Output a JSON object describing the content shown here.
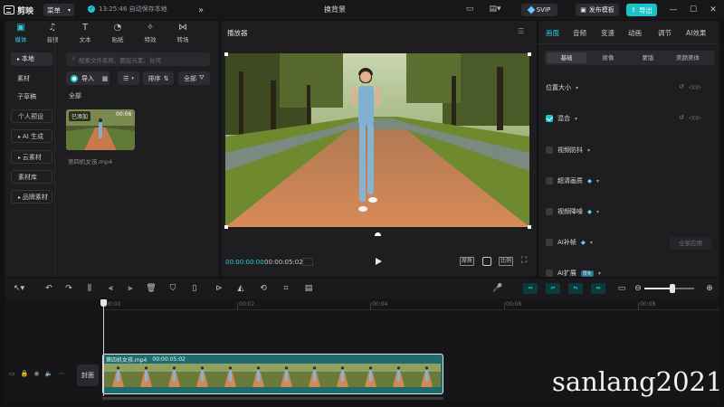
{
  "titlebar": {
    "logo_text": "剪映",
    "menu_label": "菜单",
    "save_status": "13:25:46 自动保存本地",
    "project_title": "换背景",
    "svip_label": "SVIP",
    "publish_label": "发布模板",
    "export_label": "导出"
  },
  "media_tabs": [
    {
      "label": "媒体",
      "icon": "media-icon",
      "active": true
    },
    {
      "label": "音频",
      "icon": "audio-icon"
    },
    {
      "label": "文本",
      "icon": "text-icon"
    },
    {
      "label": "贴纸",
      "icon": "sticker-icon"
    },
    {
      "label": "特效",
      "icon": "effects-icon"
    },
    {
      "label": "转场",
      "icon": "transition-icon"
    }
  ],
  "left_nav": [
    {
      "label": "本地",
      "active": true,
      "arrow": true
    },
    {
      "label": "素材"
    },
    {
      "label": "子草稿"
    },
    {
      "label": "个人预设",
      "boxed": true
    },
    {
      "label": "AI 生成",
      "boxed": true,
      "arrow": true
    },
    {
      "label": "云素材",
      "boxed": true,
      "arrow": true
    },
    {
      "label": "素材库",
      "boxed": true
    },
    {
      "label": "品牌素材",
      "boxed": true,
      "arrow": true
    }
  ],
  "media": {
    "search_placeholder": "搜索文件名称、图层元素、台词",
    "import_label": "导入",
    "sort_label": "排序",
    "filter_label": "全部",
    "all_label": "全部",
    "clip": {
      "badge": "已添加",
      "duration": "00:06",
      "name": "第四机女孩.mp4"
    }
  },
  "player": {
    "title": "播放器",
    "current_time": "00:00:00:00",
    "total_time": "00:00:05:02",
    "ratio_label": "原质",
    "compare_label": "比例"
  },
  "right_panel": {
    "tabs": [
      {
        "label": "画面",
        "active": true
      },
      {
        "label": "音频"
      },
      {
        "label": "变速"
      },
      {
        "label": "动画"
      },
      {
        "label": "调节"
      },
      {
        "label": "AI效果"
      }
    ],
    "subtabs": [
      {
        "label": "基础",
        "active": true
      },
      {
        "label": "抠像"
      },
      {
        "label": "蒙版"
      },
      {
        "label": "美颜美体"
      }
    ],
    "props": [
      {
        "label": "位置大小",
        "checkbox": false,
        "reset": true,
        "keyframe": true
      },
      {
        "label": "混合",
        "checkbox": true,
        "checked": true,
        "reset": true,
        "keyframe": true
      },
      {
        "label": "视频防抖",
        "checkbox": true
      },
      {
        "label": "超清画质",
        "checkbox": true,
        "vip": true
      },
      {
        "label": "视频降噪",
        "checkbox": true,
        "vip": true
      },
      {
        "label": "AI补帧",
        "checkbox": true,
        "vip": true
      },
      {
        "label": "AI扩展",
        "checkbox": true,
        "badge": "限免"
      }
    ],
    "apply_all_label": "全部应用"
  },
  "timeline": {
    "ticks": [
      "00:00",
      "00:02",
      "00:04",
      "00:06",
      "00:08"
    ],
    "cover_label": "封面",
    "clip_name": "第四机女孩.mp4",
    "clip_duration": "00:00:05:02"
  },
  "watermark": "sanlang2021",
  "colors": {
    "accent": "#1dc1c8",
    "panel": "#1e1e21",
    "background": "#121214"
  }
}
